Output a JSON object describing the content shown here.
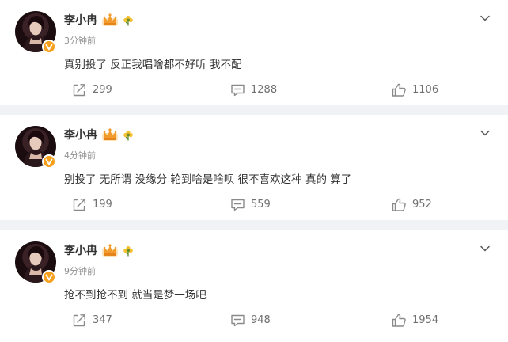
{
  "posts": [
    {
      "name": "李小冉",
      "time": "3分钟前",
      "text": "真别投了 反正我唱啥都不好听 我不配",
      "shares": "299",
      "comments": "1288",
      "likes": "1106"
    },
    {
      "name": "李小冉",
      "time": "4分钟前",
      "text": "别投了 无所谓 没缘分 轮到啥是啥呗 很不喜欢这种 真的  算了",
      "shares": "199",
      "comments": "559",
      "likes": "952"
    },
    {
      "name": "李小冉",
      "time": "9分钟前",
      "text": "抢不到抢不到 就当是梦一场吧",
      "shares": "347",
      "comments": "948",
      "likes": "1954"
    }
  ],
  "icons": {
    "avatar": "avatar",
    "verified": "verified-badge-icon",
    "vip": "crown-icon",
    "fan_badge": "flower-badge-icon",
    "menu": "chevron-down-icon",
    "share": "share-icon",
    "comment": "comment-icon",
    "like": "thumbs-up-icon"
  },
  "colors": {
    "page_bg": "#f1f2f5",
    "card_bg": "#ffffff",
    "verified": "#f7a01d",
    "muted": "#939393",
    "action": "#707070"
  }
}
